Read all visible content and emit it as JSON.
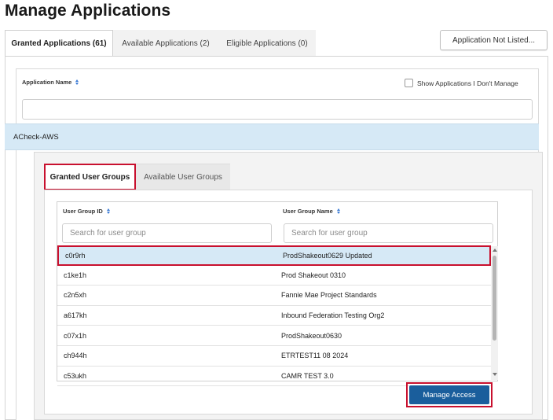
{
  "page": {
    "title": "Manage Applications"
  },
  "top_tabs": [
    {
      "label": "Granted Applications (61)",
      "active": true
    },
    {
      "label": "Available Applications (2)",
      "active": false
    },
    {
      "label": "Eligible Applications (0)",
      "active": false
    }
  ],
  "header_actions": {
    "not_listed_label": "Application Not Listed..."
  },
  "applications": {
    "column_header": "Application Name",
    "show_unmanaged_label": "Show Applications I Don't Manage",
    "show_unmanaged_checked": false,
    "filter_value": "",
    "selected_app": "ACheck-AWS"
  },
  "inner_tabs": [
    {
      "label": "Granted User Groups",
      "active": true
    },
    {
      "label": "Available User Groups",
      "active": false
    }
  ],
  "user_groups": {
    "columns": {
      "id": "User Group ID",
      "name": "User Group Name"
    },
    "search_placeholder_id": "Search for user group",
    "search_placeholder_name": "Search for user group",
    "rows": [
      {
        "id": "c0r9rh",
        "name": "ProdShakeout0629 Updated",
        "selected": true
      },
      {
        "id": "c1ke1h",
        "name": "Prod Shakeout 0310",
        "selected": false
      },
      {
        "id": "c2n5xh",
        "name": "Fannie Mae Project Standards",
        "selected": false
      },
      {
        "id": "a617kh",
        "name": "Inbound Federation Testing Org2",
        "selected": false
      },
      {
        "id": "c07x1h",
        "name": "ProdShakeout0630",
        "selected": false
      },
      {
        "id": "ch944h",
        "name": "ETRTEST11 08 2024",
        "selected": false
      },
      {
        "id": "c53ukh",
        "name": "CAMR TEST 3.0",
        "selected": false
      }
    ]
  },
  "actions": {
    "manage_access_label": "Manage Access"
  },
  "colors": {
    "primary_button": "#1a5e9c",
    "selected_row": "#d6e9f6",
    "highlight_outline": "#c8102e",
    "sort_icon": "#3a7bd5"
  },
  "icons": {
    "sort": "sort-updown-icon",
    "scroll_up": "scroll-up-arrow-icon",
    "scroll_down": "scroll-down-arrow-icon"
  }
}
